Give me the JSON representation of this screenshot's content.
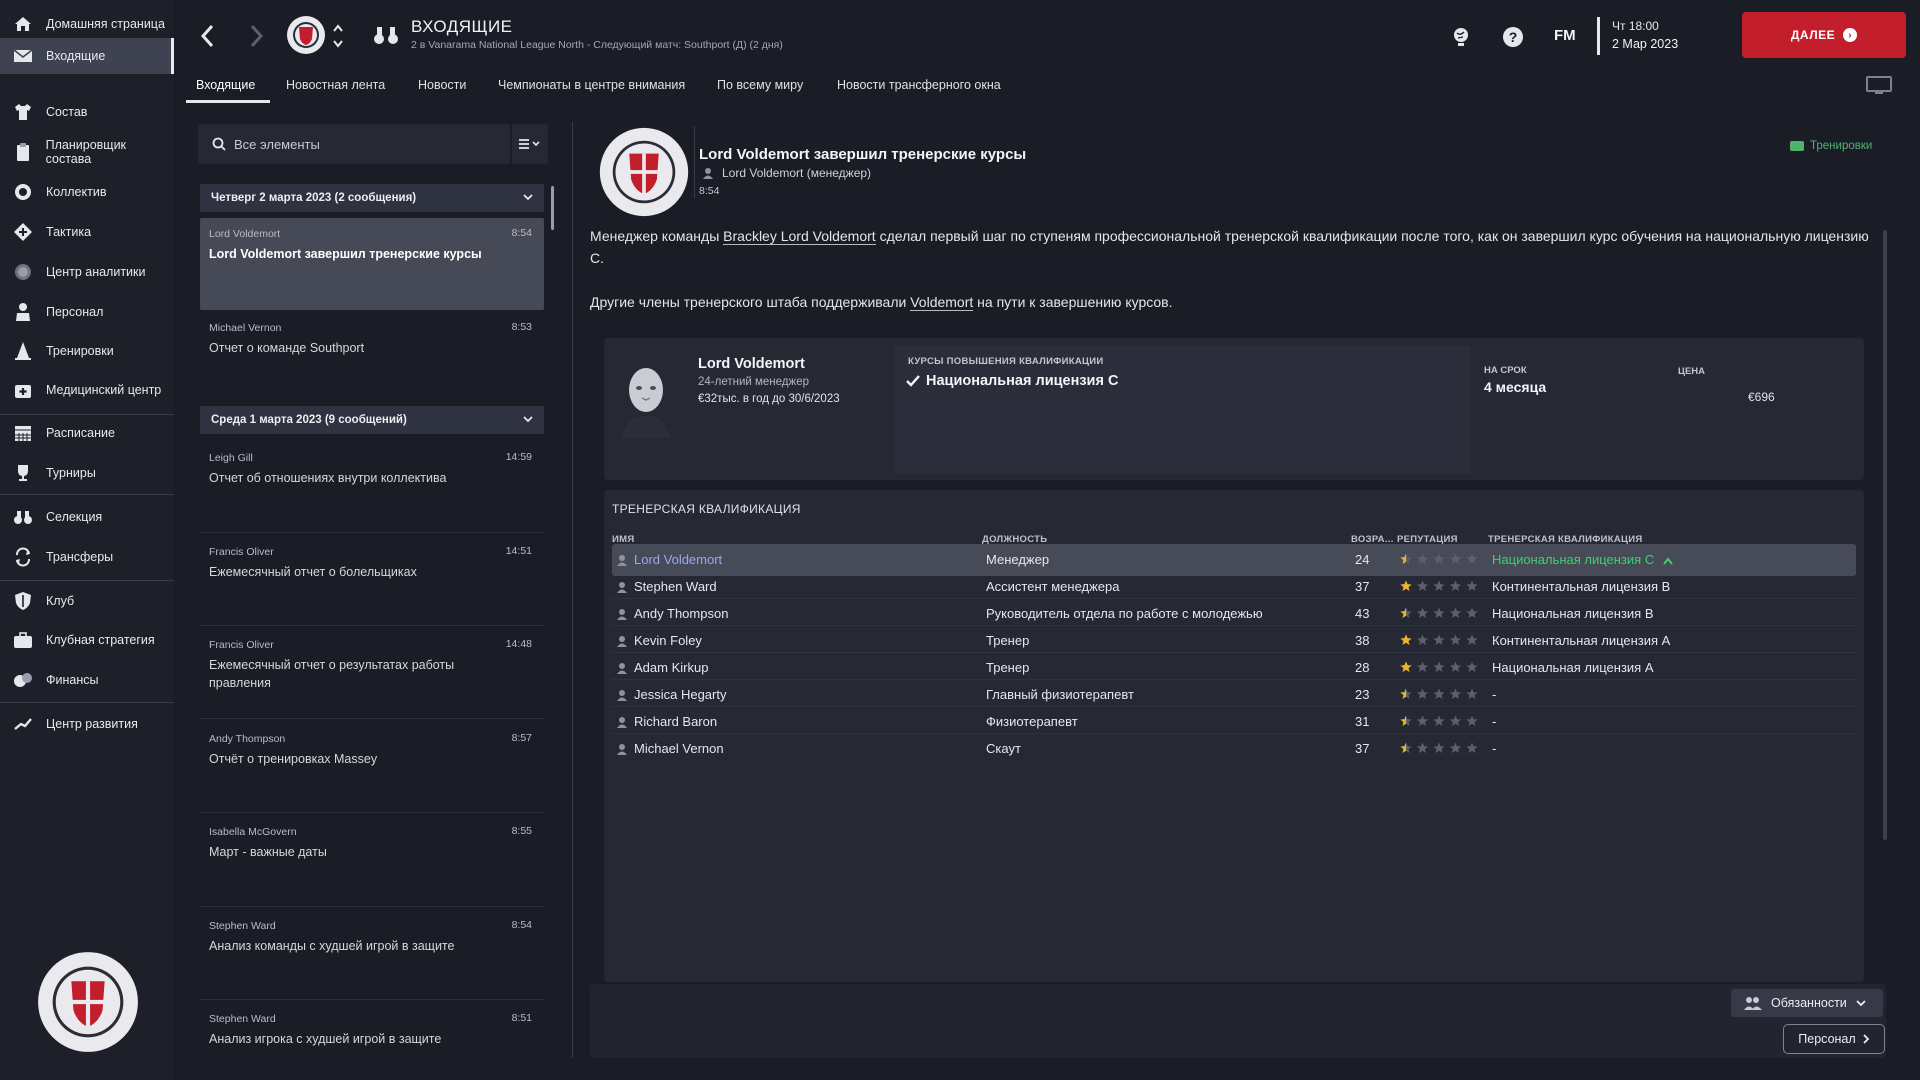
{
  "sidebar": {
    "items": [
      {
        "label": "Домашняя страница",
        "icon": "home-icon"
      },
      {
        "label": "Входящие",
        "icon": "envelope-icon",
        "active": true
      },
      {
        "label": "Состав",
        "icon": "shirt-icon"
      },
      {
        "label": "Планировщик состава",
        "icon": "clipboard-icon"
      },
      {
        "label": "Коллектив",
        "icon": "group-icon"
      },
      {
        "label": "Тактика",
        "icon": "tactics-icon"
      },
      {
        "label": "Центр аналитики",
        "icon": "analytics-icon"
      },
      {
        "label": "Персонал",
        "icon": "staff-icon"
      },
      {
        "label": "Тренировки",
        "icon": "training-cone-icon"
      },
      {
        "label": "Медицинский центр",
        "icon": "medical-icon"
      },
      {
        "label": "Расписание",
        "icon": "calendar-icon"
      },
      {
        "label": "Турниры",
        "icon": "trophy-icon"
      },
      {
        "label": "Селекция",
        "icon": "binoculars-icon"
      },
      {
        "label": "Трансферы",
        "icon": "transfers-icon"
      },
      {
        "label": "Клуб",
        "icon": "shield-icon"
      },
      {
        "label": "Клубная стратегия",
        "icon": "strategy-icon"
      },
      {
        "label": "Финансы",
        "icon": "finances-icon"
      },
      {
        "label": "Центр развития",
        "icon": "development-icon"
      }
    ]
  },
  "header": {
    "title": "ВХОДЯЩИЕ",
    "subtitle": "2 в Vanarama National League North - Следующий матч: Southport (Д) (2 дня)",
    "brand": "FM",
    "day_time": "Чт 18:00",
    "date": "2 Мар 2023",
    "continue_label": "ДАЛЕЕ"
  },
  "tabs": [
    {
      "label": "Входящие",
      "active": true
    },
    {
      "label": "Новостная лента"
    },
    {
      "label": "Новости"
    },
    {
      "label": "Чемпионаты в центре внимания"
    },
    {
      "label": "По всему миру"
    },
    {
      "label": "Новости трансферного окна"
    }
  ],
  "search": {
    "placeholder": "Все элементы"
  },
  "messages": {
    "groups": [
      {
        "header": "Четверг 2 марта 2023 (2 сообщения)",
        "items": [
          {
            "sender": "Lord Voldemort",
            "time": "8:54",
            "subject": "Lord Voldemort завершил тренерские курсы",
            "selected": true
          },
          {
            "sender": "Michael Vernon",
            "time": "8:53",
            "subject": "Отчет о команде Southport"
          }
        ]
      },
      {
        "header": "Среда 1 марта 2023 (9 сообщений)",
        "items": [
          {
            "sender": "Leigh Gill",
            "time": "14:59",
            "subject": "Отчет об отношениях внутри коллектива"
          },
          {
            "sender": "Francis Oliver",
            "time": "14:51",
            "subject": "Ежемесячный отчет о болельщиках"
          },
          {
            "sender": "Francis Oliver",
            "time": "14:48",
            "subject": "Ежемесячный отчет о результатах работы правления"
          },
          {
            "sender": "Andy Thompson",
            "time": "8:57",
            "subject": "Отчёт о тренировках Massey"
          },
          {
            "sender": "Isabella McGovern",
            "time": "8:55",
            "subject": "Март - важные даты"
          },
          {
            "sender": "Stephen Ward",
            "time": "8:54",
            "subject": "Анализ команды с худшей игрой в защите"
          },
          {
            "sender": "Stephen Ward",
            "time": "8:51",
            "subject": "Анализ игрока с худшей игрой в защите"
          }
        ]
      }
    ]
  },
  "detail": {
    "title": "Lord Voldemort завершил тренерские курсы",
    "author": "Lord Voldemort  (менеджер)",
    "time": "8:54",
    "tag": "Тренировки",
    "para1_a": "Менеджер команды ",
    "para1_link": "Brackley Lord Voldemort",
    "para1_b": " сделал первый шаг по ступеням профессиональной тренерской квалификации после того, как он завершил курс обучения на национальную лицензию C.",
    "para2_a": "Другие члены тренерского штаба поддерживали ",
    "para2_link": "Voldemort",
    "para2_b": " на пути к завершению курсов."
  },
  "course_card": {
    "name": "Lord Voldemort",
    "age": "24-летний менеджер",
    "contract": "€32тыс. в год до 30/6/2023",
    "courses_label": "КУРСЫ ПОВЫШЕНИЯ КВАЛИФИКАЦИИ",
    "course": "Национальная лицензия C",
    "term_label": "НА СРОК",
    "term": "4 месяца",
    "price_label": "ЦЕНА",
    "price": "€696"
  },
  "qualifications": {
    "title": "ТРЕНЕРСКАЯ КВАЛИФИКАЦИЯ",
    "headers": {
      "name": "ИМЯ",
      "position": "ДОЛЖНОСТЬ",
      "age": "ВОЗРА...",
      "reputation": "РЕПУТАЦИЯ",
      "qualification": "ТРЕНЕРСКАЯ КВАЛИФИКАЦИЯ"
    },
    "rows": [
      {
        "name": "Lord Voldemort",
        "position": "Менеджер",
        "age": "24",
        "stars": 0.5,
        "qualification": "Национальная лицензия C",
        "selected": true
      },
      {
        "name": "Stephen Ward",
        "position": "Ассистент менеджера",
        "age": "37",
        "stars": 1,
        "qualification": "Континентальная лицензия B"
      },
      {
        "name": "Andy Thompson",
        "position": "Руководитель отдела по работе с молодежью",
        "age": "43",
        "stars": 0.5,
        "qualification": "Национальная лицензия B"
      },
      {
        "name": "Kevin Foley",
        "position": "Тренер",
        "age": "38",
        "stars": 1,
        "qualification": "Континентальная лицензия A"
      },
      {
        "name": "Adam Kirkup",
        "position": "Тренер",
        "age": "28",
        "stars": 1,
        "qualification": "Национальная лицензия A"
      },
      {
        "name": "Jessica Hegarty",
        "position": "Главный физиотерапевт",
        "age": "23",
        "stars": 0.5,
        "qualification": "-"
      },
      {
        "name": "Richard Baron",
        "position": "Физиотерапевт",
        "age": "31",
        "stars": 0.5,
        "qualification": "-"
      },
      {
        "name": "Michael Vernon",
        "position": "Скаут",
        "age": "37",
        "stars": 0.5,
        "qualification": "-"
      }
    ]
  },
  "footer": {
    "duties_label": "Обязанности",
    "staff_label": "Персонал"
  },
  "colors": {
    "accent_red": "#c31e2b",
    "positive_green": "#3fd06e",
    "star_gold": "#f0b429",
    "link_blue": "#9aa7f0"
  }
}
